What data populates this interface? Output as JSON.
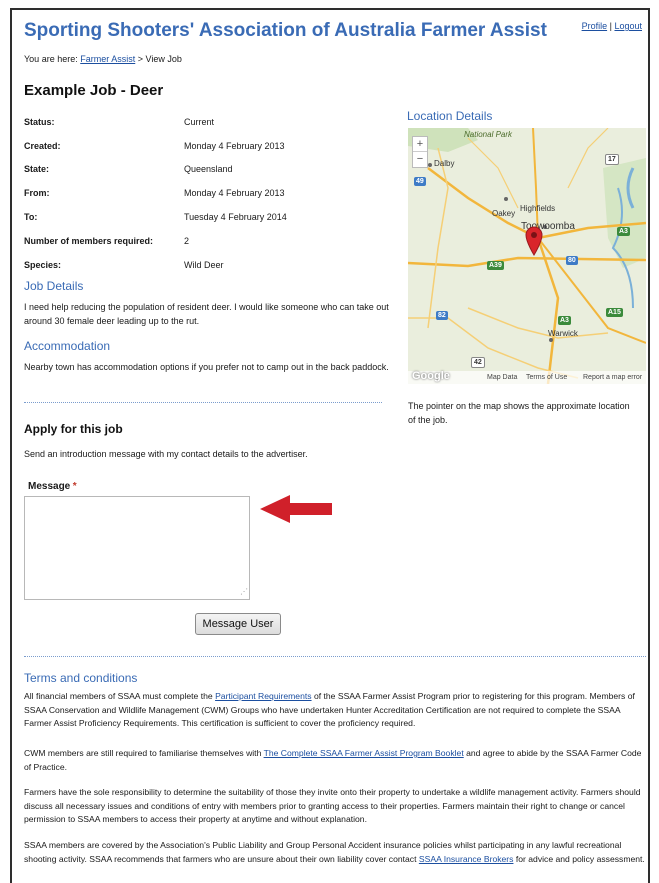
{
  "header": {
    "site_title": "Sporting Shooters' Association of Australia Farmer Assist",
    "profile_link": "Profile",
    "separator": "|",
    "logout_link": "Logout"
  },
  "breadcrumb": {
    "prefix": "You are here:",
    "home": "Farmer Assist",
    "sep": ">",
    "current": "View Job"
  },
  "job": {
    "title": "Example Job - Deer",
    "details": [
      {
        "label": "Status:",
        "value": "Current"
      },
      {
        "label": "Created:",
        "value": "Monday 4 February 2013"
      },
      {
        "label": "State:",
        "value": "Queensland"
      },
      {
        "label": "From:",
        "value": "Monday 4 February 2013"
      },
      {
        "label": "To:",
        "value": "Tuesday 4 February 2014"
      },
      {
        "label": "Number of members required:",
        "value": "2"
      },
      {
        "label": "Species:",
        "value": "Wild Deer"
      }
    ],
    "job_details_heading": "Job Details",
    "job_details_text": "I need help reducing the population of resident deer. I would like someone who can take out around 30 female deer leading up to the rut.",
    "accommodation_heading": "Accommodation",
    "accommodation_text": "Nearby town has accommodation options if you prefer not to camp out in the back paddock."
  },
  "location": {
    "heading": "Location Details",
    "caption": "The pointer on the map shows the approximate location of the job.",
    "map_labels": {
      "national_park": "National Park",
      "dalby": "Dalby",
      "oakey": "Oakey",
      "highfields": "Highfields",
      "toowoomba": "Toowoomba",
      "warwick": "Warwick",
      "google": "Google",
      "map_data": "Map Data",
      "terms": "Terms of Use",
      "report": "Report a map error",
      "zoom_in": "+",
      "zoom_out": "−"
    },
    "road_shields": [
      "49",
      "17",
      "A39",
      "80",
      "A3",
      "82",
      "A3",
      "A15",
      "42"
    ]
  },
  "apply": {
    "heading": "Apply for this job",
    "description": "Send an introduction message with my contact details to the advertiser.",
    "message_label": "Message",
    "required_mark": "*",
    "message_value": "",
    "button_label": "Message User"
  },
  "terms": {
    "heading": "Terms and conditions",
    "p1_a": "All financial members of SSAA must complete the ",
    "p1_link": "Participant Requirements",
    "p1_b": " of the SSAA Farmer Assist Program prior to registering for this program. Members of SSAA Conservation and Wildlife Management (CWM) Groups who have undertaken Hunter Accreditation Certification are not required to complete the SSAA Farmer Assist Proficiency Requirements. This certification is sufficient to cover the proficiency required.",
    "p2_a": "CWM members are still required to familiarise themselves with ",
    "p2_link": "The Complete SSAA Farmer Assist Program Booklet",
    "p2_b": " and agree to abide by the SSAA Farmer Code of Practice.",
    "p3": "Farmers have the sole responsibility to determine the suitability of those they invite onto their property to undertake a wildlife management activity. Farmers should discuss all necessary issues and conditions of entry with members prior to granting access to their properties. Farmers maintain their right to change or cancel permission to SSAA members to access their property at anytime and without explanation.",
    "p4_a": "SSAA members are covered by the Association's Public Liability and Group Personal Accident insurance policies whilst participating in any lawful recreational shooting activity. SSAA recommends that farmers who are unsure about their own liability cover contact ",
    "p4_link": "SSAA Insurance Brokers",
    "p4_b": " for advice and policy assessment."
  },
  "colors": {
    "accent": "#3a6bb5",
    "link": "#1c4fa0",
    "arrow": "#d0202a",
    "pin": "#d9252b"
  }
}
